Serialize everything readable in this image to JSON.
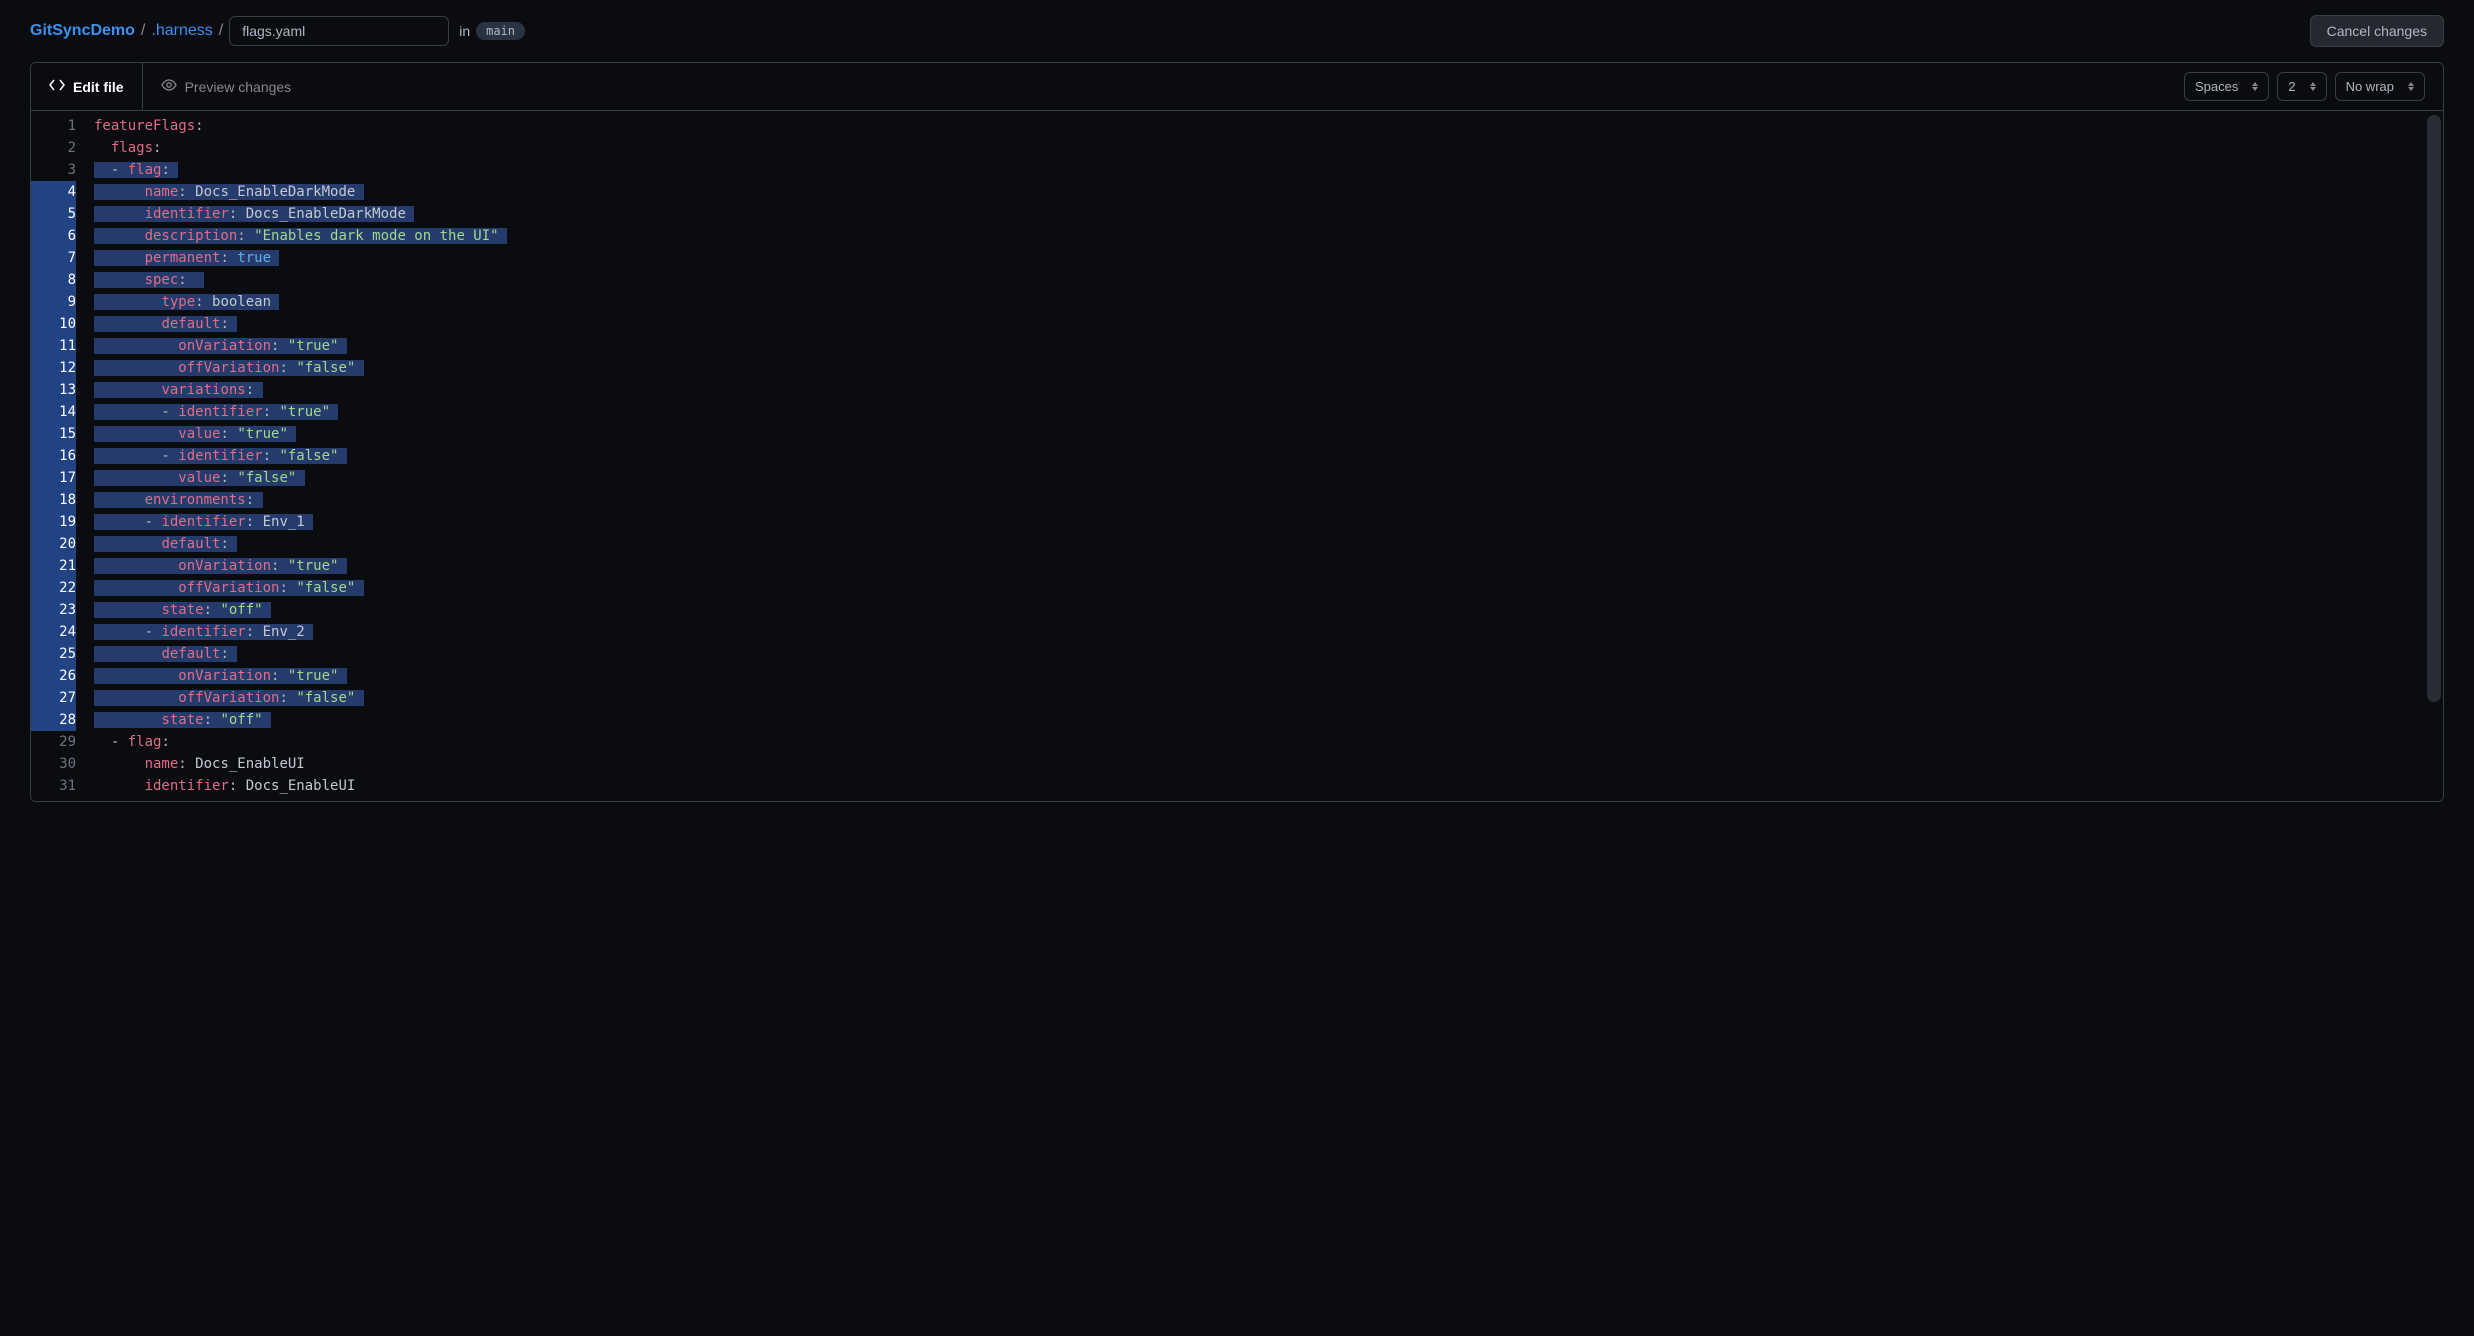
{
  "breadcrumb": {
    "root": "GitSyncDemo",
    "sep": "/",
    "folder": ".harness",
    "filename": "flags.yaml",
    "in_label": "in",
    "branch": "main"
  },
  "actions": {
    "cancel": "Cancel changes"
  },
  "tabs": {
    "edit": "Edit file",
    "preview": "Preview changes"
  },
  "toolbar": {
    "indent_type": "Spaces",
    "indent_size": "2",
    "wrap": "No wrap"
  },
  "gutter_start": 1,
  "gutter_end": 31,
  "selection_start": 4,
  "selection_end": 28,
  "code_lines": [
    {
      "n": 1,
      "hl": false,
      "tokens": [
        {
          "t": "featureFlags",
          "c": "k"
        },
        {
          "t": ":",
          "c": "p"
        }
      ]
    },
    {
      "n": 2,
      "hl": false,
      "tokens": [
        {
          "t": "  ",
          "c": "p"
        },
        {
          "t": "flags",
          "c": "k"
        },
        {
          "t": ":",
          "c": "p"
        }
      ]
    },
    {
      "n": 3,
      "hl": true,
      "tokens": [
        {
          "t": "  - ",
          "c": "p"
        },
        {
          "t": "flag",
          "c": "k"
        },
        {
          "t": ":",
          "c": "p"
        },
        {
          "t": " ",
          "c": "p"
        }
      ]
    },
    {
      "n": 4,
      "hl": true,
      "tokens": [
        {
          "t": "      ",
          "c": "p"
        },
        {
          "t": "name",
          "c": "k"
        },
        {
          "t": ": ",
          "c": "p"
        },
        {
          "t": "Docs_EnableDarkMode",
          "c": "v"
        },
        {
          "t": " ",
          "c": "p"
        }
      ]
    },
    {
      "n": 5,
      "hl": true,
      "tokens": [
        {
          "t": "      ",
          "c": "p"
        },
        {
          "t": "identifier",
          "c": "k"
        },
        {
          "t": ": ",
          "c": "p"
        },
        {
          "t": "Docs_EnableDarkMode",
          "c": "v"
        },
        {
          "t": " ",
          "c": "p"
        }
      ]
    },
    {
      "n": 6,
      "hl": true,
      "tokens": [
        {
          "t": "      ",
          "c": "p"
        },
        {
          "t": "description",
          "c": "k"
        },
        {
          "t": ": ",
          "c": "p"
        },
        {
          "t": "\"Enables dark mode on the UI\"",
          "c": "s"
        },
        {
          "t": " ",
          "c": "p"
        }
      ]
    },
    {
      "n": 7,
      "hl": true,
      "tokens": [
        {
          "t": "      ",
          "c": "p"
        },
        {
          "t": "permanent",
          "c": "k"
        },
        {
          "t": ": ",
          "c": "p"
        },
        {
          "t": "true",
          "c": "b"
        },
        {
          "t": " ",
          "c": "p"
        }
      ]
    },
    {
      "n": 8,
      "hl": true,
      "tokens": [
        {
          "t": "      ",
          "c": "p"
        },
        {
          "t": "spec",
          "c": "k"
        },
        {
          "t": ":",
          "c": "p"
        },
        {
          "t": "  ",
          "c": "p"
        }
      ]
    },
    {
      "n": 9,
      "hl": true,
      "tokens": [
        {
          "t": "        ",
          "c": "p"
        },
        {
          "t": "type",
          "c": "k"
        },
        {
          "t": ": ",
          "c": "p"
        },
        {
          "t": "boolean",
          "c": "v"
        },
        {
          "t": " ",
          "c": "p"
        }
      ]
    },
    {
      "n": 10,
      "hl": true,
      "tokens": [
        {
          "t": "        ",
          "c": "p"
        },
        {
          "t": "default",
          "c": "k"
        },
        {
          "t": ":",
          "c": "p"
        },
        {
          "t": " ",
          "c": "p"
        }
      ]
    },
    {
      "n": 11,
      "hl": true,
      "tokens": [
        {
          "t": "          ",
          "c": "p"
        },
        {
          "t": "onVariation",
          "c": "k"
        },
        {
          "t": ": ",
          "c": "p"
        },
        {
          "t": "\"true\"",
          "c": "s"
        },
        {
          "t": " ",
          "c": "p"
        }
      ]
    },
    {
      "n": 12,
      "hl": true,
      "tokens": [
        {
          "t": "          ",
          "c": "p"
        },
        {
          "t": "offVariation",
          "c": "k"
        },
        {
          "t": ": ",
          "c": "p"
        },
        {
          "t": "\"false\"",
          "c": "s"
        },
        {
          "t": " ",
          "c": "p"
        }
      ]
    },
    {
      "n": 13,
      "hl": true,
      "tokens": [
        {
          "t": "        ",
          "c": "p"
        },
        {
          "t": "variations",
          "c": "k"
        },
        {
          "t": ":",
          "c": "p"
        },
        {
          "t": " ",
          "c": "p"
        }
      ]
    },
    {
      "n": 14,
      "hl": true,
      "tokens": [
        {
          "t": "        - ",
          "c": "p"
        },
        {
          "t": "identifier",
          "c": "k"
        },
        {
          "t": ": ",
          "c": "p"
        },
        {
          "t": "\"true\"",
          "c": "s"
        },
        {
          "t": " ",
          "c": "p"
        }
      ]
    },
    {
      "n": 15,
      "hl": true,
      "tokens": [
        {
          "t": "          ",
          "c": "p"
        },
        {
          "t": "value",
          "c": "k"
        },
        {
          "t": ": ",
          "c": "p"
        },
        {
          "t": "\"true\"",
          "c": "s"
        },
        {
          "t": " ",
          "c": "p"
        }
      ]
    },
    {
      "n": 16,
      "hl": true,
      "tokens": [
        {
          "t": "        - ",
          "c": "p"
        },
        {
          "t": "identifier",
          "c": "k"
        },
        {
          "t": ": ",
          "c": "p"
        },
        {
          "t": "\"false\"",
          "c": "s"
        },
        {
          "t": " ",
          "c": "p"
        }
      ]
    },
    {
      "n": 17,
      "hl": true,
      "tokens": [
        {
          "t": "          ",
          "c": "p"
        },
        {
          "t": "value",
          "c": "k"
        },
        {
          "t": ": ",
          "c": "p"
        },
        {
          "t": "\"false\"",
          "c": "s"
        },
        {
          "t": " ",
          "c": "p"
        }
      ]
    },
    {
      "n": 18,
      "hl": true,
      "tokens": [
        {
          "t": "      ",
          "c": "p"
        },
        {
          "t": "environments",
          "c": "k"
        },
        {
          "t": ":",
          "c": "p"
        },
        {
          "t": " ",
          "c": "p"
        }
      ]
    },
    {
      "n": 19,
      "hl": true,
      "tokens": [
        {
          "t": "      - ",
          "c": "p"
        },
        {
          "t": "identifier",
          "c": "k"
        },
        {
          "t": ": ",
          "c": "p"
        },
        {
          "t": "Env_1",
          "c": "v"
        },
        {
          "t": " ",
          "c": "p"
        }
      ]
    },
    {
      "n": 20,
      "hl": true,
      "tokens": [
        {
          "t": "        ",
          "c": "p"
        },
        {
          "t": "default",
          "c": "k"
        },
        {
          "t": ":",
          "c": "p"
        },
        {
          "t": " ",
          "c": "p"
        }
      ]
    },
    {
      "n": 21,
      "hl": true,
      "tokens": [
        {
          "t": "          ",
          "c": "p"
        },
        {
          "t": "onVariation",
          "c": "k"
        },
        {
          "t": ": ",
          "c": "p"
        },
        {
          "t": "\"true\"",
          "c": "s"
        },
        {
          "t": " ",
          "c": "p"
        }
      ]
    },
    {
      "n": 22,
      "hl": true,
      "tokens": [
        {
          "t": "          ",
          "c": "p"
        },
        {
          "t": "offVariation",
          "c": "k"
        },
        {
          "t": ": ",
          "c": "p"
        },
        {
          "t": "\"false\"",
          "c": "s"
        },
        {
          "t": " ",
          "c": "p"
        }
      ]
    },
    {
      "n": 23,
      "hl": true,
      "tokens": [
        {
          "t": "        ",
          "c": "p"
        },
        {
          "t": "state",
          "c": "k"
        },
        {
          "t": ": ",
          "c": "p"
        },
        {
          "t": "\"off\"",
          "c": "s"
        },
        {
          "t": " ",
          "c": "p"
        }
      ]
    },
    {
      "n": 24,
      "hl": true,
      "tokens": [
        {
          "t": "      - ",
          "c": "p"
        },
        {
          "t": "identifier",
          "c": "k"
        },
        {
          "t": ": ",
          "c": "p"
        },
        {
          "t": "Env_2",
          "c": "v"
        },
        {
          "t": " ",
          "c": "p"
        }
      ]
    },
    {
      "n": 25,
      "hl": true,
      "tokens": [
        {
          "t": "        ",
          "c": "p"
        },
        {
          "t": "default",
          "c": "k"
        },
        {
          "t": ":",
          "c": "p"
        },
        {
          "t": " ",
          "c": "p"
        }
      ]
    },
    {
      "n": 26,
      "hl": true,
      "tokens": [
        {
          "t": "          ",
          "c": "p"
        },
        {
          "t": "onVariation",
          "c": "k"
        },
        {
          "t": ": ",
          "c": "p"
        },
        {
          "t": "\"true\"",
          "c": "s"
        },
        {
          "t": " ",
          "c": "p"
        }
      ]
    },
    {
      "n": 27,
      "hl": true,
      "tokens": [
        {
          "t": "          ",
          "c": "p"
        },
        {
          "t": "offVariation",
          "c": "k"
        },
        {
          "t": ": ",
          "c": "p"
        },
        {
          "t": "\"false\"",
          "c": "s"
        },
        {
          "t": " ",
          "c": "p"
        }
      ]
    },
    {
      "n": 28,
      "hl": true,
      "tokens": [
        {
          "t": "        ",
          "c": "p"
        },
        {
          "t": "state",
          "c": "k"
        },
        {
          "t": ": ",
          "c": "p"
        },
        {
          "t": "\"off\"",
          "c": "s"
        },
        {
          "t": " ",
          "c": "p"
        }
      ]
    },
    {
      "n": 29,
      "hl": false,
      "tokens": [
        {
          "t": "  - ",
          "c": "p"
        },
        {
          "t": "flag",
          "c": "k"
        },
        {
          "t": ":",
          "c": "p"
        }
      ]
    },
    {
      "n": 30,
      "hl": false,
      "tokens": [
        {
          "t": "      ",
          "c": "p"
        },
        {
          "t": "name",
          "c": "k"
        },
        {
          "t": ": ",
          "c": "p"
        },
        {
          "t": "Docs_EnableUI",
          "c": "v"
        }
      ]
    },
    {
      "n": 31,
      "hl": false,
      "tokens": [
        {
          "t": "      ",
          "c": "p"
        },
        {
          "t": "identifier",
          "c": "k"
        },
        {
          "t": ": ",
          "c": "p"
        },
        {
          "t": "Docs_EnableUI",
          "c": "v"
        }
      ]
    }
  ]
}
